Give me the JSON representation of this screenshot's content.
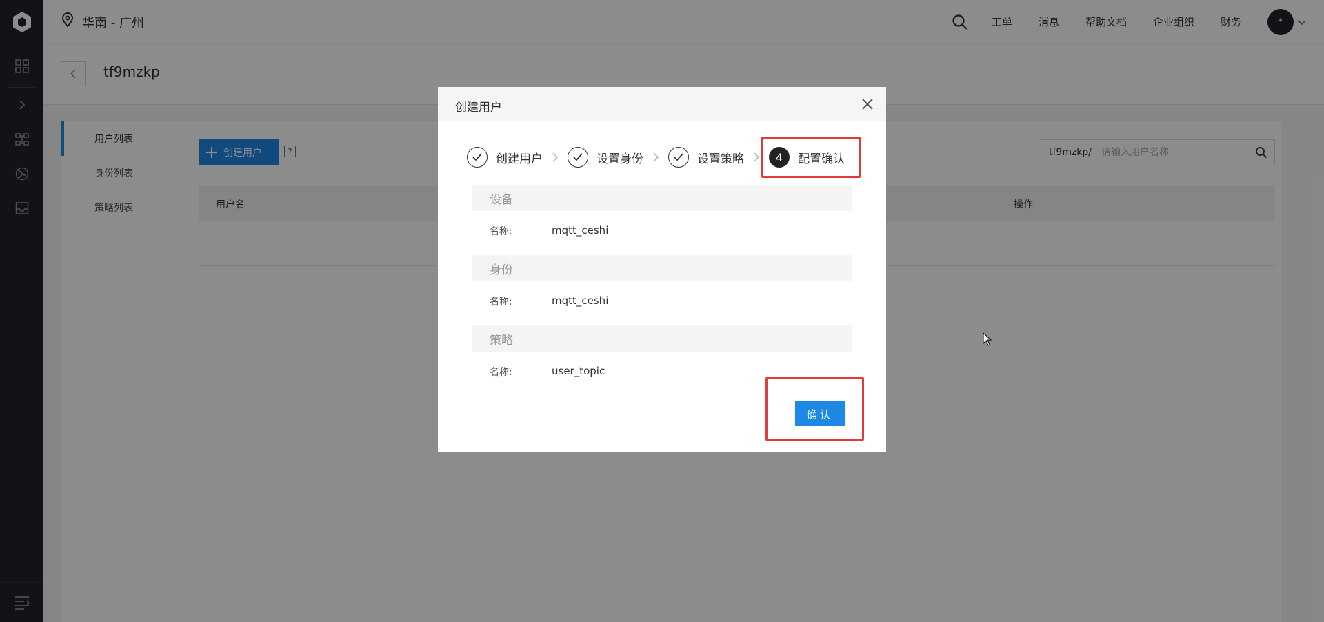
{
  "topbar": {
    "region": "华南 - 广州",
    "nav": [
      "工单",
      "消息",
      "帮助文档",
      "企业组织",
      "财务"
    ],
    "avatar_text": "*"
  },
  "page": {
    "title": "tf9mzkp"
  },
  "submenu": {
    "items": [
      "用户列表",
      "身份列表",
      "策略列表"
    ]
  },
  "main": {
    "create_button": "创建用户",
    "help": "?",
    "search_prefix": "tf9mzkp/",
    "search_placeholder": "请输入用户名称",
    "table_headers": [
      "用户名",
      "操作"
    ]
  },
  "modal": {
    "title": "创建用户",
    "steps": [
      {
        "label": "创建用户",
        "state": "done"
      },
      {
        "label": "设置身份",
        "state": "done"
      },
      {
        "label": "设置策略",
        "state": "done"
      },
      {
        "label": "配置确认",
        "state": "current",
        "number": "4"
      }
    ],
    "sections": [
      {
        "title": "设备",
        "key": "名称:",
        "value": "mqtt_ceshi"
      },
      {
        "title": "身份",
        "key": "名称:",
        "value": "mqtt_ceshi"
      },
      {
        "title": "策略",
        "key": "名称:",
        "value": "user_topic"
      }
    ],
    "confirm_button": "确认"
  },
  "colors": {
    "accent": "#1e88e5",
    "highlight": "#e23b3b",
    "rail": "#1f2329"
  }
}
